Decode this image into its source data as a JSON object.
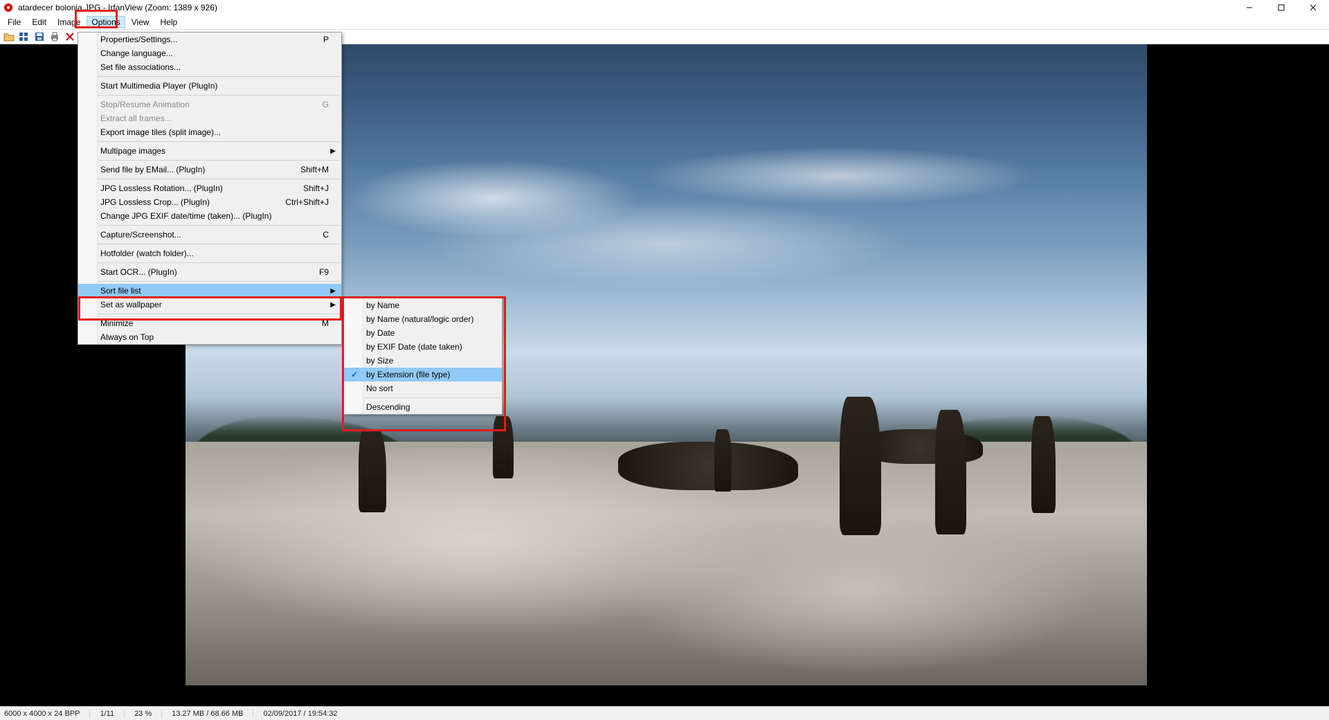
{
  "title": "atardecer bolonia.JPG - IrfanView (Zoom: 1389 x 926)",
  "menubar": {
    "file": "File",
    "edit": "Edit",
    "image": "Image",
    "options": "Options",
    "view": "View",
    "help": "Help"
  },
  "options_menu": {
    "properties": "Properties/Settings...",
    "properties_sc": "P",
    "change_language": "Change language...",
    "set_file_assoc": "Set file associations...",
    "start_multimedia": "Start Multimedia Player (PlugIn)",
    "stop_resume": "Stop/Resume Animation",
    "stop_resume_sc": "G",
    "extract_frames": "Extract all frames...",
    "export_tiles": "Export image tiles (split image)...",
    "multipage": "Multipage images",
    "send_email": "Send file by EMail... (PlugIn)",
    "send_email_sc": "Shift+M",
    "jpg_rotation": "JPG Lossless Rotation... (PlugIn)",
    "jpg_rotation_sc": "Shift+J",
    "jpg_crop": "JPG Lossless Crop... (PlugIn)",
    "jpg_crop_sc": "Ctrl+Shift+J",
    "change_exif": "Change JPG EXIF date/time (taken)... (PlugIn)",
    "capture": "Capture/Screenshot...",
    "capture_sc": "C",
    "hotfolder": "Hotfolder (watch folder)...",
    "start_ocr": "Start OCR... (PlugIn)",
    "start_ocr_sc": "F9",
    "sort_file_list": "Sort file list",
    "set_wallpaper": "Set as wallpaper",
    "minimize": "Minimize",
    "minimize_sc": "M",
    "always_on_top": "Always on Top"
  },
  "sort_menu": {
    "by_name": "by Name",
    "by_name_natural": "by Name (natural/logic order)",
    "by_date": "by Date",
    "by_exif": "by EXIF Date (date taken)",
    "by_size": "by Size",
    "by_extension": "by Extension (file type)",
    "no_sort": "No sort",
    "descending": "Descending"
  },
  "status": {
    "dims": "6000 x 4000 x 24 BPP",
    "index": "1/11",
    "zoom": "23 %",
    "mem": "13.27 MB / 68.66 MB",
    "datetime": "02/09/2017 / 19:54:32"
  }
}
